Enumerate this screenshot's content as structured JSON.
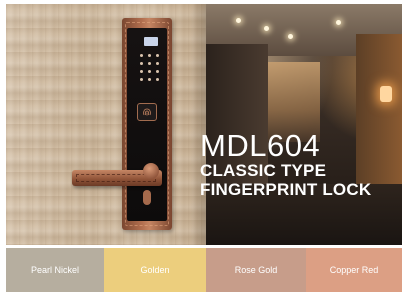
{
  "headline": {
    "model": "MDL604",
    "line1": "CLASSIC TYPE",
    "line2": "FINGERPRINT LOCK"
  },
  "finishes": [
    {
      "label": "Pearl Nickel",
      "color": "#b6ae9f"
    },
    {
      "label": "Golden",
      "color": "#ecce7d"
    },
    {
      "label": "Rose Gold",
      "color": "#c79d8a"
    },
    {
      "label": "Copper Red",
      "color": "#dc9f84"
    }
  ],
  "product": {
    "icon": "door-lock-icon",
    "finish_color": "#b26f4f"
  }
}
